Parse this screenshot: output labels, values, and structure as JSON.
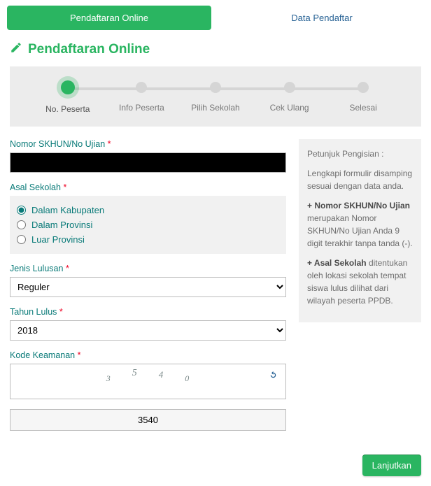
{
  "tabs": {
    "active": "Pendaftaran Online",
    "inactive": "Data Pendaftar"
  },
  "title": "Pendaftaran Online",
  "stepper": [
    "No. Peserta",
    "Info Peserta",
    "Pilih Sekolah",
    "Cek Ulang",
    "Selesai"
  ],
  "labels": {
    "skhun": "Nomor SKHUN/No Ujian",
    "asal": "Asal Sekolah",
    "jenis": "Jenis Lulusan",
    "tahun": "Tahun Lulus",
    "kode": "Kode Keamanan"
  },
  "asal_options": {
    "opt1": "Dalam Kabupaten",
    "opt2": "Dalam Provinsi",
    "opt3": "Luar Provinsi"
  },
  "jenis_value": "Reguler",
  "tahun_value": "2018",
  "captcha": {
    "d1": "3",
    "d2": "5",
    "d3": "4",
    "d4": "0"
  },
  "captcha_answer": "3540",
  "side": {
    "h": "Petunjuk Pengisian :",
    "p1": "Lengkapi formulir disamping sesuai dengan data anda.",
    "p2a": "+ Nomor SKHUN/No Ujian",
    "p2b": "merupakan Nomor SKHUN/No Ujian Anda 9 digit terakhir tanpa tanda (-).",
    "p3a": "+ Asal Sekolah",
    "p3b": "ditentukan oleh lokasi sekolah tempat siswa lulus dilihat dari wilayah peserta PPDB."
  },
  "button_next": "Lanjutkan"
}
